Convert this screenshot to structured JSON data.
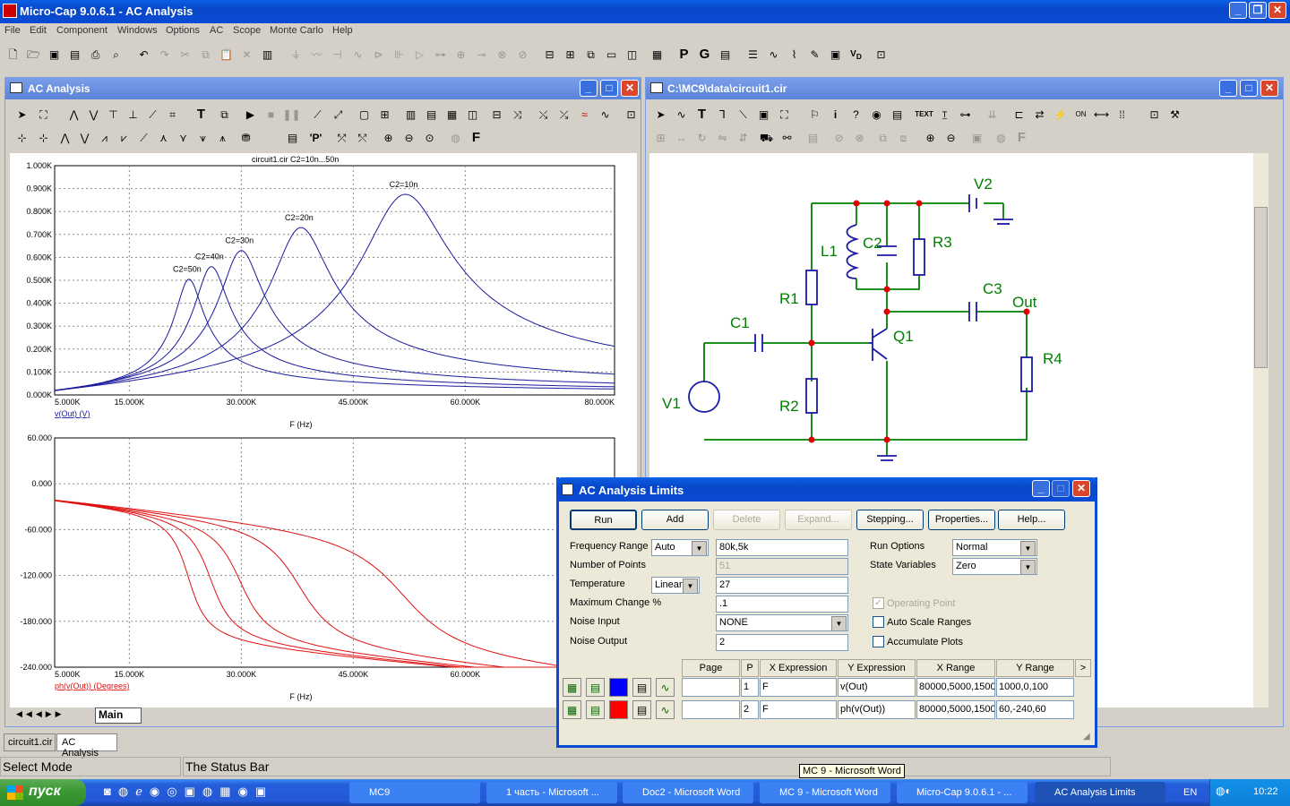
{
  "app": {
    "title": "Micro-Cap 9.0.6.1 - AC Analysis",
    "menu": [
      "File",
      "Edit",
      "Component",
      "Windows",
      "Options",
      "AC",
      "Scope",
      "Monte Carlo",
      "Help"
    ]
  },
  "left_window": {
    "title": "AC Analysis",
    "tabs": [
      "Main"
    ],
    "bottom_tabs": [
      "circuit1.cir",
      "AC Analysis"
    ]
  },
  "right_window": {
    "title": "C:\\MC9\\data\\circuit1.cir"
  },
  "colors": {
    "magnitude": "#1b1b9e",
    "phase": "#e01010",
    "wire": "#008000",
    "node": "#e00000",
    "xp_blue": "#0a4bd4"
  },
  "status": {
    "left": "Select Mode",
    "main": "The Status Bar",
    "tooltip": "MC 9 - Microsoft Word"
  },
  "schematic": {
    "labels": [
      "V2",
      "L1",
      "C2",
      "R3",
      "R1",
      "C3",
      "Out",
      "C1",
      "Q1",
      "R4",
      "V1",
      "R2"
    ]
  },
  "chart_data": [
    {
      "type": "line",
      "title": "circuit1.cir C2=10n...50n",
      "xlabel": "F (Hz)",
      "ylabel": "v(Out) (V)",
      "x_ticks": [
        "5.000K",
        "15.000K",
        "30.000K",
        "45.000K",
        "60.000K",
        "80.000K"
      ],
      "y_ticks": [
        "0.000K",
        "0.100K",
        "0.200K",
        "0.300K",
        "0.400K",
        "0.500K",
        "0.600K",
        "0.700K",
        "0.800K",
        "0.900K",
        "1.000K"
      ],
      "xlim": [
        5000,
        80000
      ],
      "ylim": [
        0,
        1000
      ],
      "grid": true,
      "annotations": [
        "C2=10n",
        "C2=20n",
        "C2=30n",
        "C2=40n",
        "C2=50n"
      ],
      "series": [
        {
          "name": "C2=10n",
          "peak_x": 52000,
          "peak_y": 875
        },
        {
          "name": "C2=20n",
          "peak_x": 38000,
          "peak_y": 730
        },
        {
          "name": "C2=30n",
          "peak_x": 30000,
          "peak_y": 630
        },
        {
          "name": "C2=40n",
          "peak_x": 26000,
          "peak_y": 560
        },
        {
          "name": "C2=50n",
          "peak_x": 23000,
          "peak_y": 505
        }
      ]
    },
    {
      "type": "line",
      "xlabel": "F (Hz)",
      "ylabel": "ph(v(Out)) (Degrees)",
      "x_ticks": [
        "5.000K",
        "15.000K",
        "30.000K",
        "45.000K",
        "60.000K"
      ],
      "y_ticks": [
        "60.000",
        "0.000",
        "-60.000",
        "-120.000",
        "-180.000",
        "-240.000"
      ],
      "xlim": [
        5000,
        80000
      ],
      "ylim": [
        -240,
        60
      ],
      "grid": true,
      "series": [
        {
          "name": "C2=10n",
          "transition_x": 52000
        },
        {
          "name": "C2=20n",
          "transition_x": 38000
        },
        {
          "name": "C2=30n",
          "transition_x": 30000
        },
        {
          "name": "C2=40n",
          "transition_x": 26000
        },
        {
          "name": "C2=50n",
          "transition_x": 23000
        }
      ]
    }
  ],
  "dialog": {
    "title": "AC Analysis Limits",
    "buttons": [
      "Run",
      "Add",
      "Delete",
      "Expand...",
      "Stepping...",
      "Properties...",
      "Help..."
    ],
    "freq_label": "Frequency Range",
    "freq_mode": "Auto",
    "freq_value": "80k,5k",
    "points_label": "Number of Points",
    "points_value": "51",
    "temp_label": "Temperature",
    "temp_mode": "Linear",
    "temp_value": "27",
    "maxch_label": "Maximum Change %",
    "maxch_value": ".1",
    "noise_in_label": "Noise Input",
    "noise_in_value": "NONE",
    "noise_out_label": "Noise Output",
    "noise_out_value": "2",
    "run_opts_label": "Run Options",
    "run_opts_value": "Normal",
    "state_label": "State Variables",
    "state_value": "Zero",
    "chk_op": "Operating Point",
    "chk_auto": "Auto Scale Ranges",
    "chk_acc": "Accumulate Plots",
    "headers": [
      "Page",
      "P",
      "X Expression",
      "Y Expression",
      "X Range",
      "Y Range",
      ">"
    ],
    "rows": [
      {
        "page": "",
        "p": "1",
        "x": "F",
        "y": "v(Out)",
        "xr": "80000,5000,1500",
        "yr": "1000,0,100",
        "color": "#0000ff"
      },
      {
        "page": "",
        "p": "2",
        "x": "F",
        "y": "ph(v(Out))",
        "xr": "80000,5000,1500",
        "yr": "60,-240,60",
        "color": "#ff0000"
      }
    ]
  },
  "taskbar": {
    "start": "пуск",
    "items": [
      "MC9",
      "1 часть - Microsoft ...",
      "Doc2 - Microsoft Word",
      "MC 9 - Microsoft Word",
      "Micro-Cap 9.0.6.1 - ...",
      "AC Analysis Limits"
    ],
    "lang": "EN",
    "clock": "10:22"
  }
}
